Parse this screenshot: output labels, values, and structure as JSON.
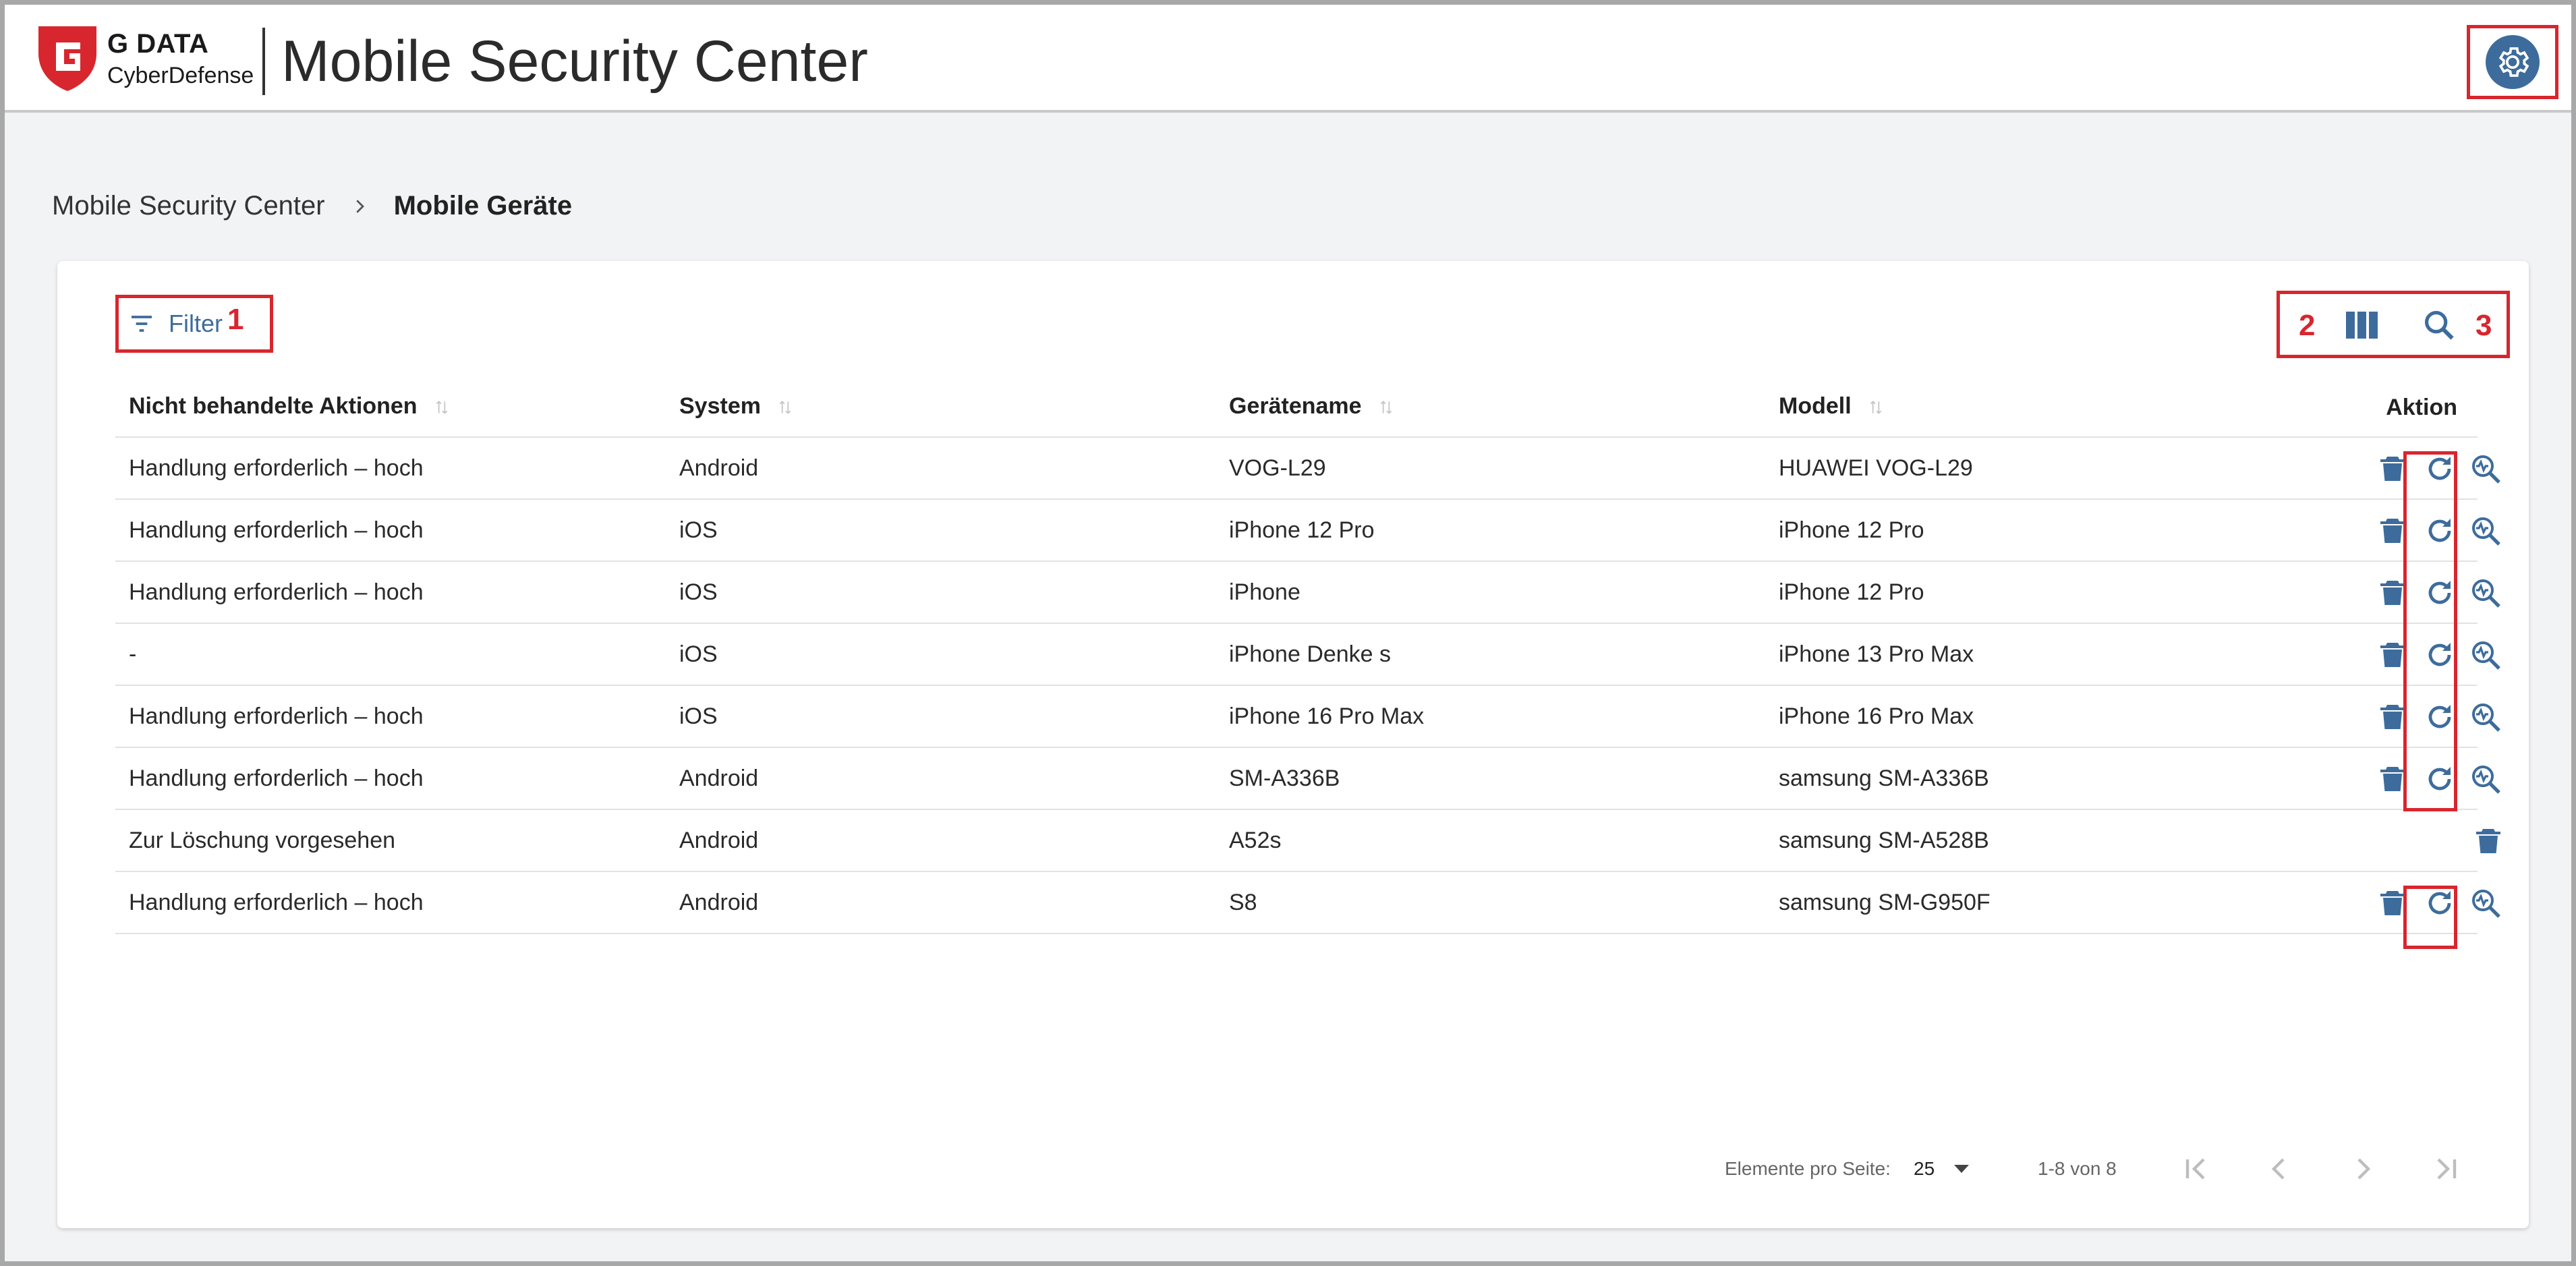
{
  "app": {
    "brand_top": "G DATA",
    "brand_bottom": "CyberDefense",
    "title": "Mobile Security Center",
    "settings_icon": "gear-icon",
    "accent": "#3d6c9c",
    "brand_red": "#d8262e"
  },
  "breadcrumb": {
    "items": [
      "Mobile Security Center",
      "Mobile Geräte"
    ]
  },
  "toolbar": {
    "filter_label": "Filter",
    "marker_filter": "1",
    "marker_columns": "2",
    "marker_search": "3"
  },
  "table": {
    "headers": [
      "Nicht behandelte Aktionen",
      "System",
      "Gerätename",
      "Modell",
      "Aktion"
    ],
    "rows": [
      {
        "actions": "Handlung erforderlich – hoch",
        "system": "Android",
        "device": "VOG-L29",
        "model": "HUAWEI VOG-L29",
        "buttons": [
          "delete",
          "reload",
          "scan"
        ]
      },
      {
        "actions": "Handlung erforderlich – hoch",
        "system": "iOS",
        "device": "iPhone 12 Pro",
        "model": "iPhone 12 Pro",
        "buttons": [
          "delete",
          "reload",
          "scan"
        ]
      },
      {
        "actions": "Handlung erforderlich – hoch",
        "system": "iOS",
        "device": "iPhone",
        "model": "iPhone 12 Pro",
        "buttons": [
          "delete",
          "reload",
          "scan"
        ]
      },
      {
        "actions": "-",
        "system": "iOS",
        "device": "iPhone Denke s",
        "model": "iPhone 13 Pro Max",
        "buttons": [
          "delete",
          "reload",
          "scan"
        ]
      },
      {
        "actions": "Handlung erforderlich – hoch",
        "system": "iOS",
        "device": "iPhone 16 Pro Max",
        "model": "iPhone 16 Pro Max",
        "buttons": [
          "delete",
          "reload",
          "scan"
        ]
      },
      {
        "actions": "Handlung erforderlich – hoch",
        "system": "Android",
        "device": "SM-A336B",
        "model": "samsung SM-A336B",
        "buttons": [
          "delete",
          "reload",
          "scan"
        ]
      },
      {
        "actions": "Zur Löschung vorgesehen",
        "system": "Android",
        "device": "A52s",
        "model": "samsung SM-A528B",
        "buttons": [
          "delete"
        ]
      },
      {
        "actions": "Handlung erforderlich – hoch",
        "system": "Android",
        "device": "S8",
        "model": "samsung SM-G950F",
        "buttons": [
          "delete",
          "reload",
          "scan"
        ]
      }
    ]
  },
  "pagination": {
    "items_per_page_label": "Elemente pro Seite:",
    "items_per_page": "25",
    "range": "1-8 von 8"
  }
}
